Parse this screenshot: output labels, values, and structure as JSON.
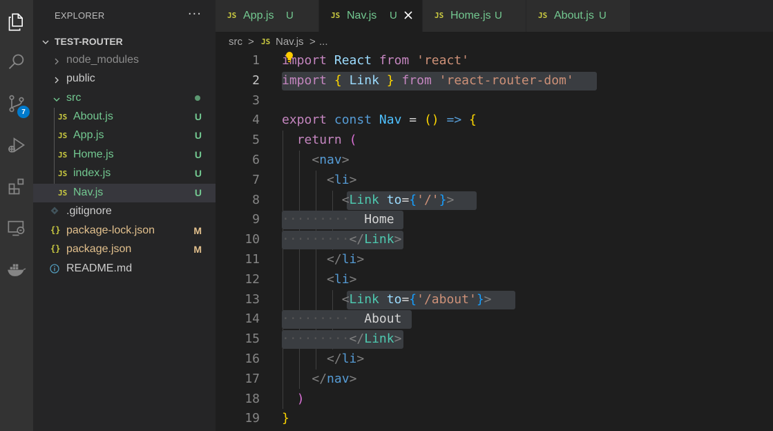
{
  "colors": {
    "accent": "#007acc",
    "untracked": "#73c991",
    "modified": "#e2c08d",
    "js_icon": "#cbcb41"
  },
  "activity_bar": {
    "icons": [
      "files-icon",
      "search-icon",
      "source-control-icon",
      "run-debug-icon",
      "extensions-icon",
      "remote-explorer-icon",
      "docker-icon"
    ],
    "scm_badge": "7"
  },
  "sidebar": {
    "title": "EXPLORER",
    "more": "···",
    "root": "TEST-ROUTER",
    "items": [
      {
        "label": "node_modules",
        "type": "folder",
        "badge": ""
      },
      {
        "label": "public",
        "type": "folder",
        "badge": ""
      },
      {
        "label": "src",
        "type": "folder-open",
        "badge": ""
      },
      {
        "label": "About.js",
        "type": "js",
        "badge": "U"
      },
      {
        "label": "App.js",
        "type": "js",
        "badge": "U"
      },
      {
        "label": "Home.js",
        "type": "js",
        "badge": "U"
      },
      {
        "label": "index.js",
        "type": "js",
        "badge": "U"
      },
      {
        "label": "Nav.js",
        "type": "js",
        "badge": "U"
      },
      {
        "label": ".gitignore",
        "type": "git",
        "badge": ""
      },
      {
        "label": "package-lock.json",
        "type": "json",
        "badge": "M"
      },
      {
        "label": "package.json",
        "type": "json",
        "badge": "M"
      },
      {
        "label": "README.md",
        "type": "info",
        "badge": ""
      }
    ]
  },
  "tabs": [
    {
      "icon": "JS",
      "label": "App.js",
      "badge": "U"
    },
    {
      "icon": "JS",
      "label": "Nav.js",
      "badge": "U",
      "active": true
    },
    {
      "icon": "JS",
      "label": "Home.js",
      "badge": "U"
    },
    {
      "icon": "JS",
      "label": "About.js",
      "badge": "U"
    }
  ],
  "breadcrumb": {
    "folder": "src",
    "sep": ">",
    "icon": "JS",
    "file": "Nav.js",
    "more": "..."
  },
  "editor": {
    "line_numbers": [
      "1",
      "2",
      "3",
      "4",
      "5",
      "6",
      "7",
      "8",
      "9",
      "10",
      "11",
      "12",
      "13",
      "14",
      "15",
      "16",
      "17",
      "18",
      "19"
    ],
    "current_line": "2",
    "code": {
      "import": "import",
      "react_ident": "React",
      "from": "from",
      "react_str": "'react'",
      "brace_open": "{",
      "brace_close": "}",
      "link_ident": "Link",
      "rrd_str": "'react-router-dom'",
      "export": "export",
      "const": "const",
      "nav_ident": "Nav",
      "eq": "=",
      "parens": "()",
      "arrow": "=>",
      "return": "return",
      "paren_open": "(",
      "paren_close": ")",
      "nav_tag": "nav",
      "li_tag": "li",
      "link_comp": "Link",
      "to_attr": "to",
      "home_path": "'/'",
      "about_path": "'/about'",
      "home_text": "Home",
      "about_text": "About",
      "lt": "<",
      "gt": ">",
      "lts": "</",
      "ws_dots": "·········"
    }
  }
}
